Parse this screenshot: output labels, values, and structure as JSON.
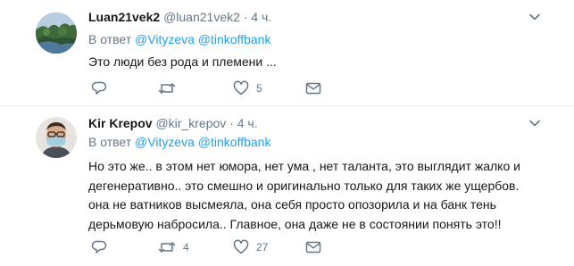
{
  "tweets": [
    {
      "display_name": "Luan21vek2",
      "handle": "@luan21vek2",
      "dot": "·",
      "time": "4 ч.",
      "reply_prefix": "В ответ",
      "mentions": [
        "@Vityzeva",
        "@tinkoffbank"
      ],
      "text_lines": [
        "Это люди без рода и племени ..."
      ],
      "replies": "",
      "retweets": "",
      "likes": "5"
    },
    {
      "display_name": "Kir Krepov",
      "handle": "@kir_krepov",
      "dot": "·",
      "time": "4 ч.",
      "reply_prefix": "В ответ",
      "mentions": [
        "@Vityzeva",
        "@tinkoffbank"
      ],
      "text_lines": [
        "Но это же.. в этом нет юмора, нет ума , нет таланта, это выглядит жалко и",
        "дегенеративно.. это смешно и оригинально только для таких же ущербов.",
        "она не ватников высмеяла, она себя просто опозорила и на банк тень",
        "дерьмовую набросила.. Главное, она даже не в состоянии понять это!!"
      ],
      "replies": "",
      "retweets": "4",
      "likes": "27"
    }
  ],
  "colors": {
    "text": "#14171a",
    "secondary": "#657786",
    "link": "#1da1f2",
    "border": "#e6ecf0"
  },
  "icons": [
    "chevron-down-icon",
    "reply-icon",
    "retweet-icon",
    "like-icon",
    "message-icon"
  ]
}
